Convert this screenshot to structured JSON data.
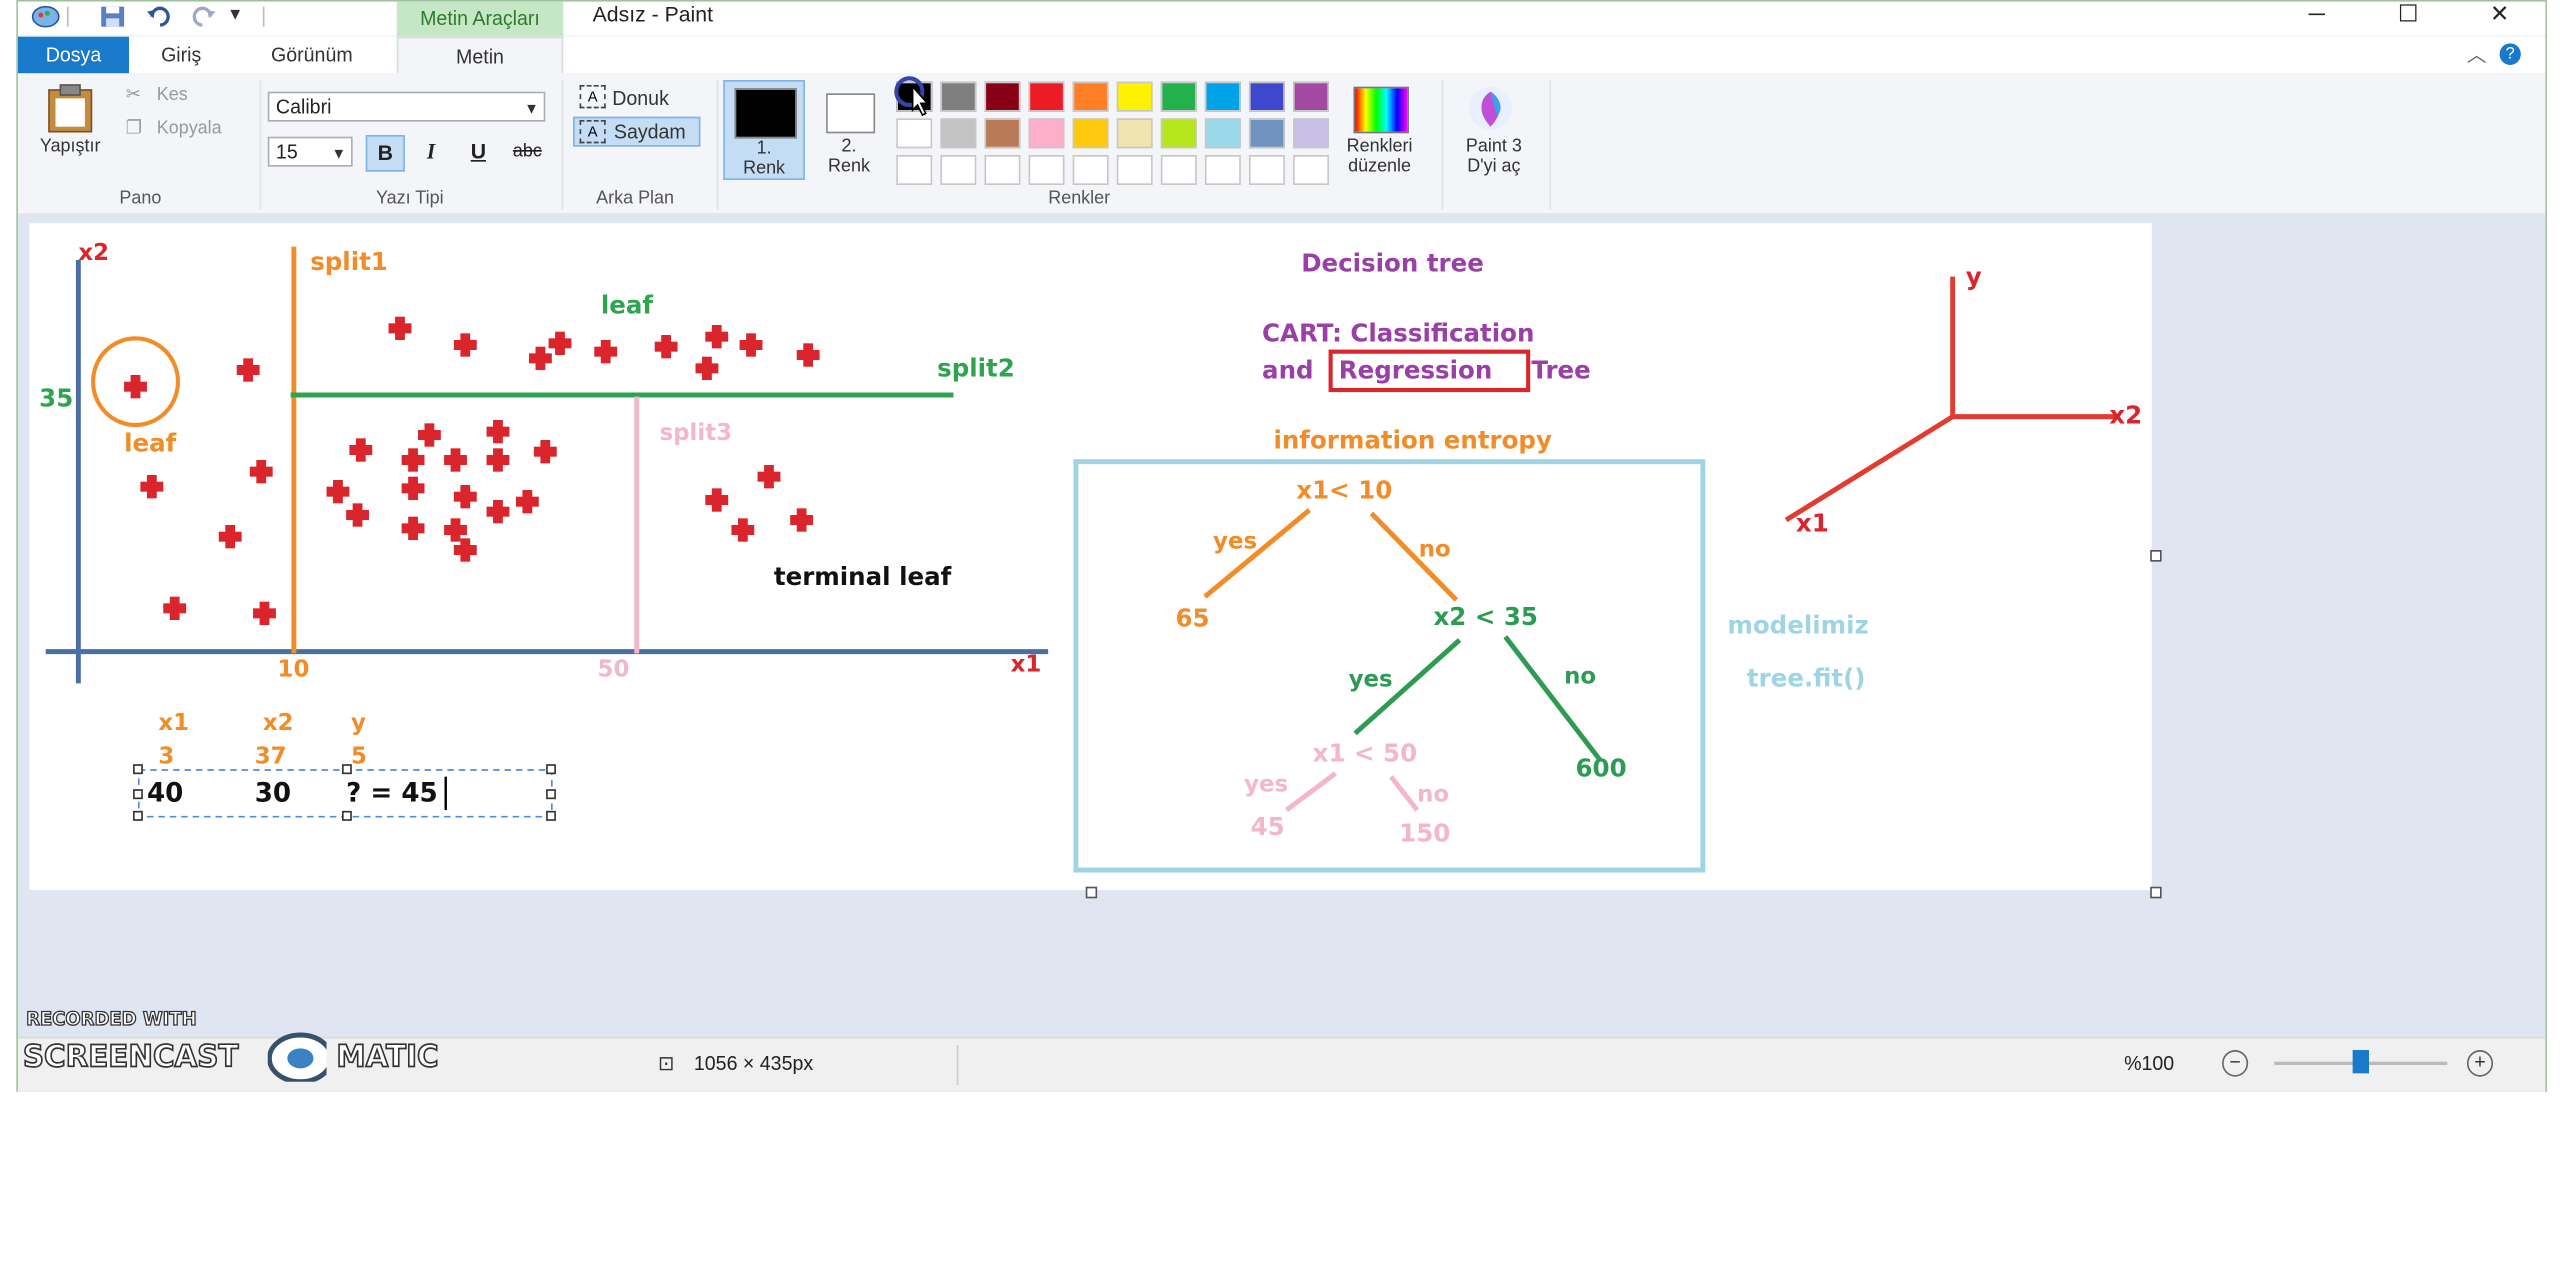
{
  "window": {
    "title": "Adsız - Paint",
    "context_tab_group": "Metin Araçları",
    "controls": {
      "minimize": "─",
      "maximize": "☐",
      "close": "✕"
    },
    "help": "?",
    "collapse": "︿"
  },
  "tabs": {
    "dosya": "Dosya",
    "giris": "Giriş",
    "gorunum": "Görünüm",
    "metin": "Metin"
  },
  "ribbon": {
    "pano": {
      "paste": "Yapıştır",
      "cut": "Kes",
      "copy": "Kopyala",
      "label": "Pano"
    },
    "font": {
      "family": "Calibri",
      "size": "15",
      "bold": "B",
      "italic": "I",
      "underline": "U",
      "strike": "abc",
      "label": "Yazı Tipi"
    },
    "background": {
      "opaque": "Donuk",
      "transparent": "Saydam",
      "label": "Arka Plan"
    },
    "colors": {
      "color1_line1": "1.",
      "color1_line2": "Renk",
      "color2_line1": "2.",
      "color2_line2": "Renk",
      "edit_line1": "Renkleri",
      "edit_line2": "düzenle",
      "paint3d_line1": "Paint 3",
      "paint3d_line2": "D'yi aç",
      "label": "Renkler",
      "color1": "#000000",
      "color2": "#ffffff",
      "palette_row1": [
        "#000000",
        "#7f7f7f",
        "#880015",
        "#ed1c24",
        "#ff7f27",
        "#fff200",
        "#22b14c",
        "#00a2e8",
        "#3f48cc",
        "#a349a4"
      ],
      "palette_row2": [
        "#ffffff",
        "#c3c3c3",
        "#b97a57",
        "#ffaec9",
        "#ffc90e",
        "#efe4b0",
        "#b5e61d",
        "#99d9ea",
        "#7092be",
        "#c8bfe7"
      ],
      "palette_row3": [
        "#ffffff",
        "#ffffff",
        "#ffffff",
        "#ffffff",
        "#ffffff",
        "#ffffff",
        "#ffffff",
        "#ffffff",
        "#ffffff",
        "#ffffff"
      ]
    }
  },
  "drawing": {
    "axis_x2": "x2",
    "axis_x1": "x1",
    "split1": "split1",
    "split2": "split2",
    "split3": "split3",
    "leaf_top": "leaf",
    "leaf_left": "leaf",
    "terminal_leaf": "terminal leaf",
    "tick_35": "35",
    "tick_10": "10",
    "tick_50": "50",
    "table_h1": "x1",
    "table_h2": "x2",
    "table_h3": "y",
    "table_r1_c1": "3",
    "table_r1_c2": "37",
    "table_r1_c3": "5",
    "input_c1": "40",
    "input_c2": "30",
    "input_c3": "? = 45",
    "decision_tree": "Decision tree",
    "cart_line1": "CART: Classification",
    "cart_and": "and",
    "cart_regression": "Regression",
    "cart_tree": "Tree",
    "info_entropy": "information entropy",
    "node_root": "x1< 10",
    "yes1": "yes",
    "no1": "no",
    "leaf_65": "65",
    "node_x2": "x2 < 35",
    "yes2": "yes",
    "no2": "no",
    "leaf_600": "600",
    "node_x1_50": "x1 < 50",
    "yes3": "yes",
    "no3": "no",
    "leaf_45": "45",
    "leaf_150": "150",
    "modelimiz": "modelimiz",
    "tree_fit": "tree.fit()",
    "axis3d_y": "y",
    "axis3d_x2": "x2",
    "axis3d_x1": "x1"
  },
  "status": {
    "canvas_size": "1056 × 435px",
    "zoom": "%100",
    "zoom_out": "−",
    "zoom_in": "+",
    "zoom_level": 0.5
  },
  "watermark": {
    "line1": "RECORDED WITH",
    "line2a": "SCREENCAST",
    "line2b": "MATIC"
  }
}
